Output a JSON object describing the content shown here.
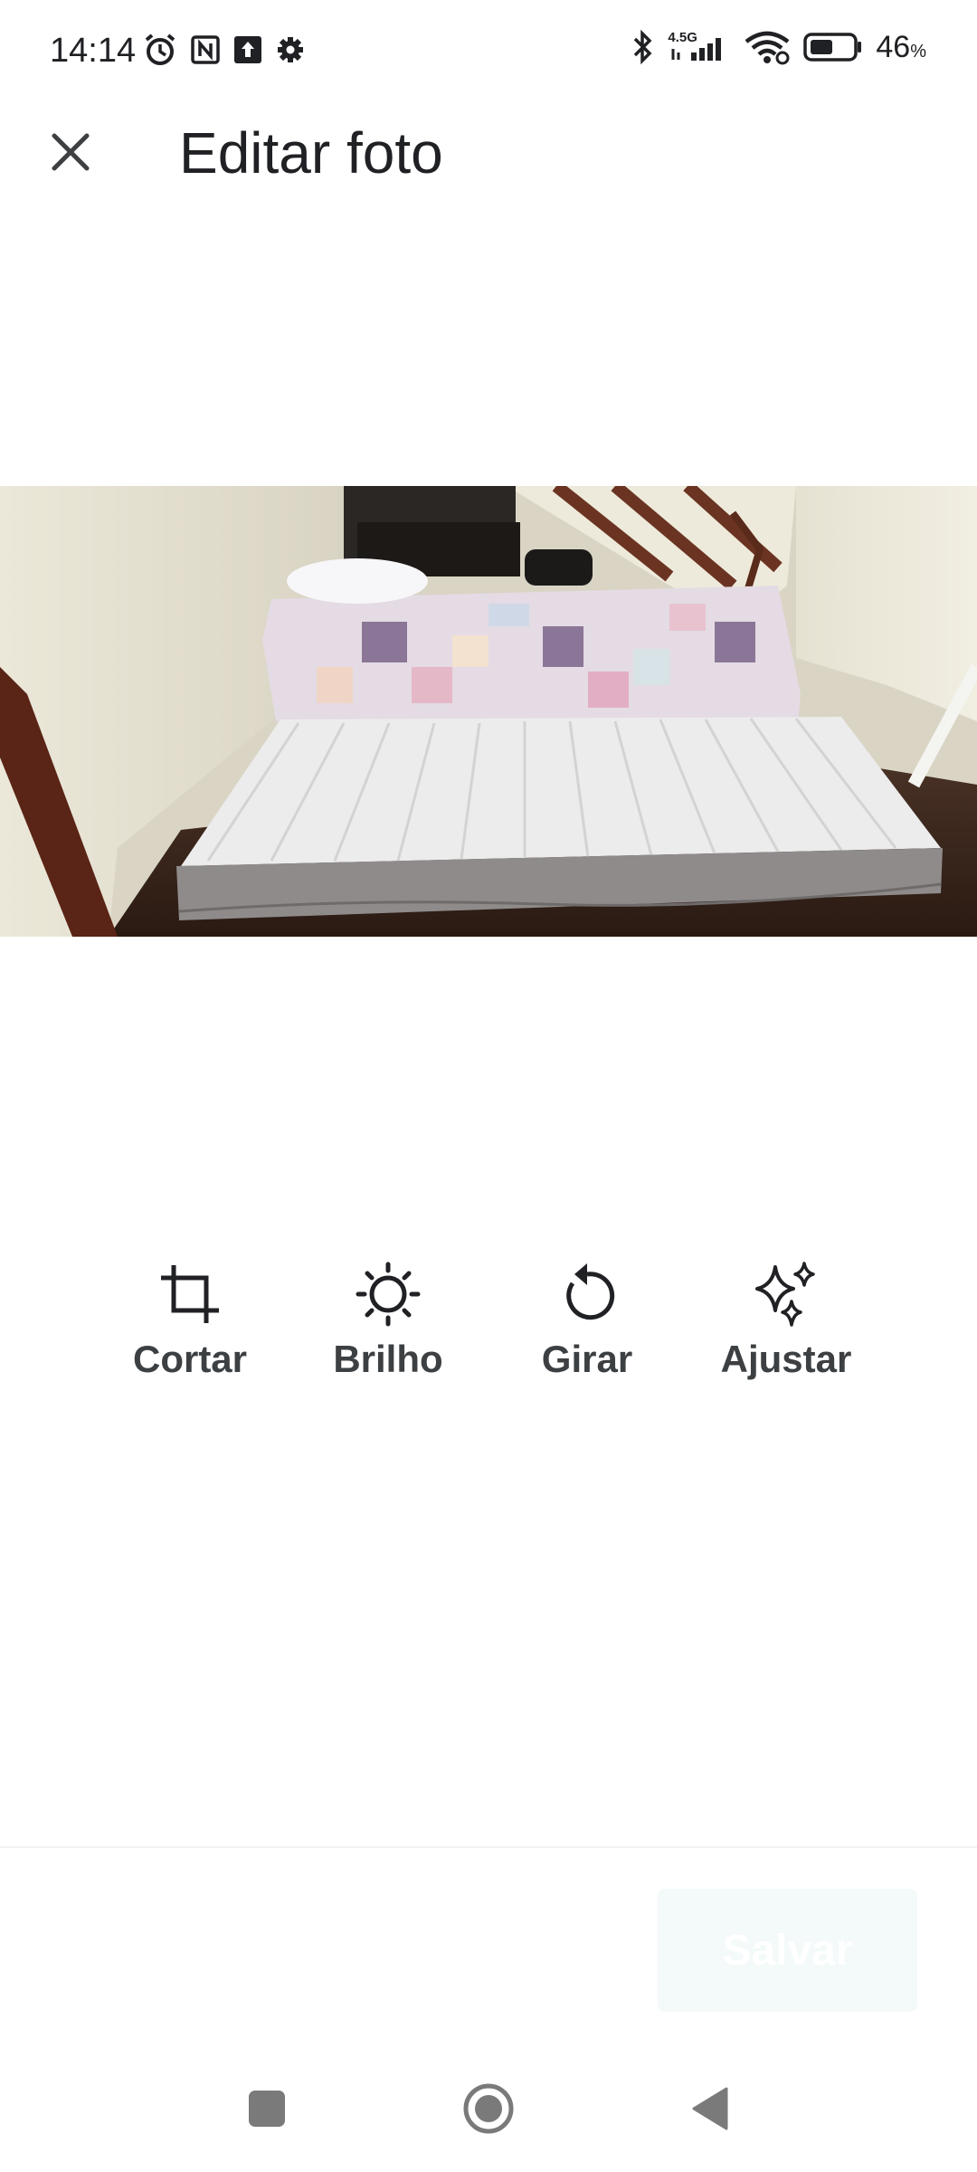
{
  "status_bar": {
    "time": "14:14",
    "network_label": "4.5G",
    "battery_percent": "46",
    "battery_unit": "%",
    "left_icons": [
      "alarm-icon",
      "nfc-icon",
      "upload-icon",
      "settings-gear-icon"
    ],
    "right_icons": [
      "bluetooth-icon",
      "signal-icon",
      "wifi-icon",
      "battery-icon"
    ]
  },
  "header": {
    "title": "Editar foto",
    "close_icon": "close-icon"
  },
  "tools": [
    {
      "label": "Cortar",
      "icon": "crop-icon"
    },
    {
      "label": "Brilho",
      "icon": "brightness-icon"
    },
    {
      "label": "Girar",
      "icon": "rotate-icon"
    },
    {
      "label": "Ajustar",
      "icon": "sparkle-icon"
    }
  ],
  "footer": {
    "save_label": "Salvar"
  },
  "nav_bar": {
    "buttons": [
      "recents-square-icon",
      "home-circle-icon",
      "back-triangle-icon"
    ]
  },
  "colors": {
    "text": "#202124",
    "tool_text": "#3c4043",
    "save_bg": "#f3faf9"
  }
}
